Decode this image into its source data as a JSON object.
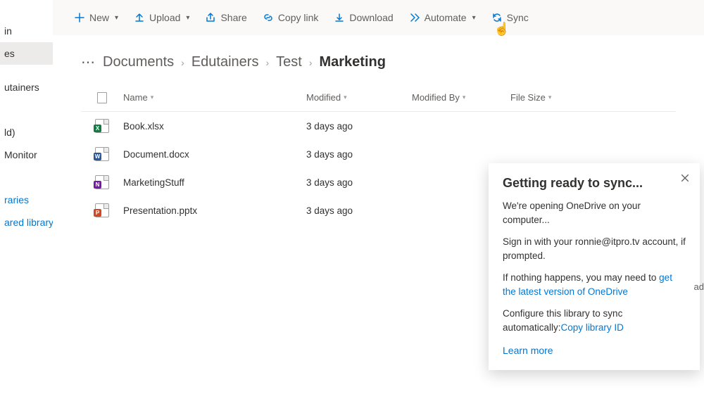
{
  "sidebar": {
    "items": [
      {
        "label": "in"
      },
      {
        "label": "es"
      },
      {
        "label": ""
      },
      {
        "label": "utainers"
      },
      {
        "label": ""
      },
      {
        "label": "ld)"
      },
      {
        "label": "Monitor"
      },
      {
        "label": ""
      },
      {
        "label": "raries"
      },
      {
        "label": "ared library"
      }
    ],
    "active_index": 1
  },
  "toolbar": {
    "new": "New",
    "upload": "Upload",
    "share": "Share",
    "copy_link": "Copy link",
    "download": "Download",
    "automate": "Automate",
    "sync": "Sync"
  },
  "breadcrumb": {
    "items": [
      "Documents",
      "Edutainers",
      "Test"
    ],
    "current": "Marketing"
  },
  "columns": {
    "name": "Name",
    "modified": "Modified",
    "modified_by": "Modified By",
    "file_size": "File Size"
  },
  "rows": [
    {
      "name": "Book.xlsx",
      "modified": "3 days ago",
      "ext": "x"
    },
    {
      "name": "Document.docx",
      "modified": "3 days ago",
      "ext": "w"
    },
    {
      "name": "MarketingStuff",
      "modified": "3 days ago",
      "ext": "n"
    },
    {
      "name": "Presentation.pptx",
      "modified": "3 days ago",
      "ext": "p"
    }
  ],
  "dialog": {
    "title": "Getting ready to sync...",
    "line1": "We're opening OneDrive on your computer...",
    "line2a": "Sign in with your ",
    "account": "ronnie@itpro.tv",
    "line2b": " account, if prompted.",
    "line3a": "If nothing happens, you may need to ",
    "link1": "get the latest version of OneDrive",
    "line4a": "Configure this library to sync automatically:",
    "link2": "Copy library ID",
    "learn": "Learn more"
  },
  "peek": "ad"
}
